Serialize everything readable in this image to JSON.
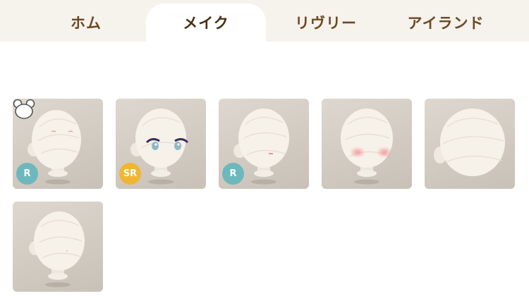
{
  "tabs": [
    {
      "label": "ホム",
      "active": false
    },
    {
      "label": "メイク",
      "active": true
    },
    {
      "label": "リヴリー",
      "active": false
    },
    {
      "label": "アイランド",
      "active": false
    }
  ],
  "colors": {
    "tab_bar_bg": "#f6f2ec",
    "tab_text": "#6b4a22",
    "card_bg": "#d6d0c8",
    "badge_r": "#6cb8bd",
    "badge_sr": "#f0b632"
  },
  "items": [
    {
      "feature": "closed-eyes",
      "rarity": "R",
      "icon": "bear-ears-icon"
    },
    {
      "feature": "anime-eyes",
      "rarity": "SR"
    },
    {
      "feature": "small-mouth",
      "rarity": "R"
    },
    {
      "feature": "blush-cheeks"
    },
    {
      "feature": "plain-head"
    },
    {
      "feature": "plain-head-side"
    }
  ]
}
